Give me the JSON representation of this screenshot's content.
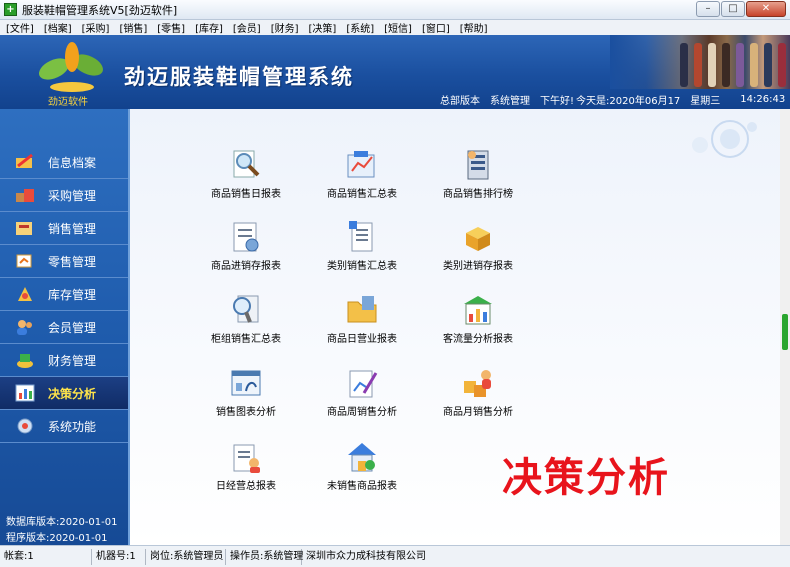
{
  "window": {
    "title": "服装鞋帽管理系统V5[劲迈软件]"
  },
  "menu": [
    "[文件]",
    "[档案]",
    "[采购]",
    "[销售]",
    "[零售]",
    "[库存]",
    "[会员]",
    "[财务]",
    "[决策]",
    "[系统]",
    "[短信]",
    "[窗口]",
    "[帮助]"
  ],
  "header": {
    "logo_text": "劲迈软件",
    "app_title": "劲迈服装鞋帽管理系统",
    "info": {
      "version": "总部版本",
      "role": "系统管理",
      "greeting": "下午好!",
      "date_label": "今天是:",
      "date": "2020年06月17",
      "weekday": "星期三",
      "time": "14:26:43"
    }
  },
  "sidebar": {
    "items": [
      {
        "label": "信息档案",
        "icon": "info-archive-icon"
      },
      {
        "label": "采购管理",
        "icon": "purchase-icon"
      },
      {
        "label": "销售管理",
        "icon": "sales-icon"
      },
      {
        "label": "零售管理",
        "icon": "retail-icon"
      },
      {
        "label": "库存管理",
        "icon": "inventory-icon"
      },
      {
        "label": "会员管理",
        "icon": "member-icon"
      },
      {
        "label": "财务管理",
        "icon": "finance-icon"
      },
      {
        "label": "决策分析",
        "icon": "decision-icon"
      },
      {
        "label": "系统功能",
        "icon": "system-icon"
      }
    ],
    "db_version": "数据库版本:2020-01-01",
    "app_version": "程序版本:2020-01-01"
  },
  "main": {
    "tiles": [
      {
        "label": "商品销售日报表",
        "icon": "magnifier-report-icon"
      },
      {
        "label": "商品销售汇总表",
        "icon": "chart-summary-icon"
      },
      {
        "label": "商品销售排行榜",
        "icon": "ranking-icon"
      },
      {
        "label": "商品进销存报表",
        "icon": "stock-report-icon"
      },
      {
        "label": "类别销售汇总表",
        "icon": "document-icon"
      },
      {
        "label": "类别进销存报表",
        "icon": "boxes-icon"
      },
      {
        "label": "柜组销售汇总表",
        "icon": "search-document-icon"
      },
      {
        "label": "商品日营业报表",
        "icon": "folder-icon"
      },
      {
        "label": "客流量分析报表",
        "icon": "bar-chart-icon"
      },
      {
        "label": "销售图表分析",
        "icon": "window-chart-icon"
      },
      {
        "label": "商品周销售分析",
        "icon": "pen-chart-icon"
      },
      {
        "label": "商品月销售分析",
        "icon": "person-boxes-icon"
      },
      {
        "label": "日经营总报表",
        "icon": "clipboard-icon"
      },
      {
        "label": "未销售商品报表",
        "icon": "house-icon"
      }
    ],
    "caption": "决策分析"
  },
  "status": {
    "account": "帐套:1",
    "machine": "机器号:1",
    "position": "岗位:系统管理员",
    "operator": "操作员:系统管理",
    "company": "深圳市众力成科技有限公司"
  },
  "colors": {
    "header_blue": "#1a4f9f",
    "active_text": "#ffe44a",
    "caption_red": "#e8141c",
    "scroll_green": "#2aa52e"
  }
}
